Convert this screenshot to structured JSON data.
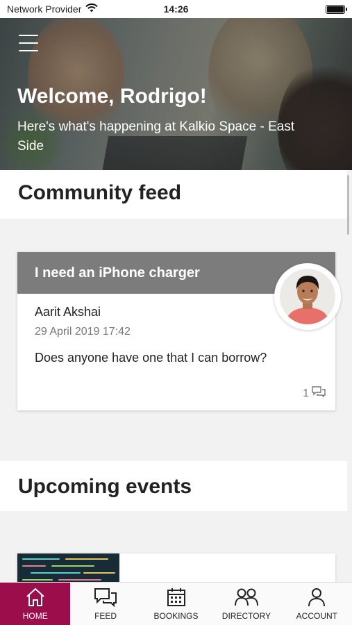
{
  "status_bar": {
    "carrier": "Network Provider",
    "time": "14:26"
  },
  "hero": {
    "title": "Welcome, Rodrigo!",
    "subtitle": "Here's what's happening at Kalkio Space - East Side"
  },
  "community": {
    "heading": "Community feed",
    "post": {
      "title": "I need an iPhone charger",
      "author": "Aarit Akshai",
      "date": "29 April 2019 17:42",
      "body": "Does anyone have one that I can borrow?",
      "comment_count": "1"
    }
  },
  "events": {
    "heading": "Upcoming events"
  },
  "tabbar": {
    "active_color": "#9c0d4c",
    "tabs": [
      {
        "label": "HOME",
        "icon": "home-icon"
      },
      {
        "label": "FEED",
        "icon": "chat-icon"
      },
      {
        "label": "BOOKINGS",
        "icon": "calendar-icon"
      },
      {
        "label": "DIRECTORY",
        "icon": "people-icon"
      },
      {
        "label": "ACCOUNT",
        "icon": "person-icon"
      }
    ]
  }
}
